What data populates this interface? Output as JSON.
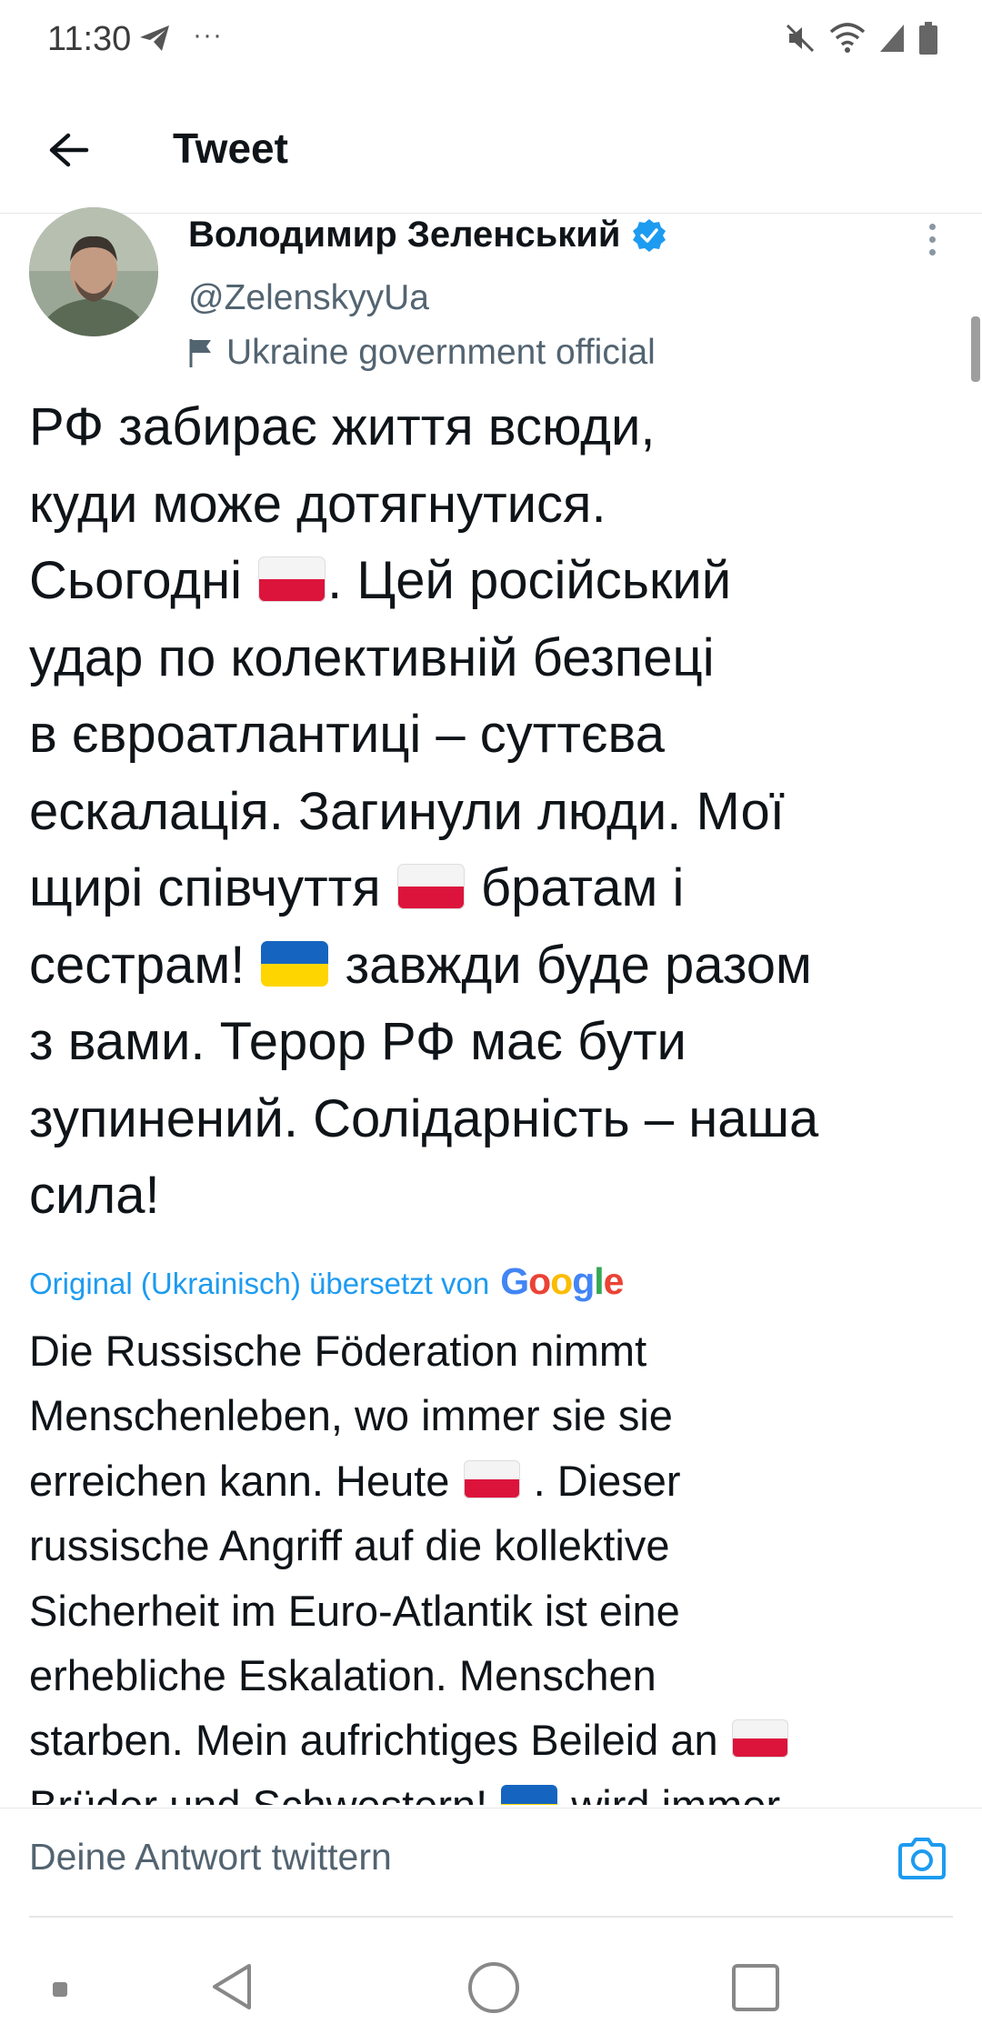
{
  "status_bar": {
    "time": "11:30",
    "notification_dots": "···",
    "icons": [
      "telegram-send-icon",
      "mute-icon",
      "wifi-icon",
      "signal-icon",
      "battery-icon"
    ]
  },
  "header": {
    "title": "Tweet"
  },
  "tweet": {
    "author_name": "Володимир Зеленський",
    "handle": "@ZelenskyyUa",
    "label": "Ukraine government official",
    "text_segments": [
      "РФ забирає життя всюди,",
      "куди може дотягнутися.",
      "Сьогодні ",
      ". Цей російський",
      "удар по колективній безпеці",
      "в євроатлантиці – суттєва",
      "ескалація. Загинули люди. Мої",
      "щирі співчуття ",
      " братам і",
      "сестрам! ",
      " завжди буде разом",
      "з вами. Терор РФ має бути",
      "зупинений. Солідарність – наша",
      "сила!"
    ],
    "translation_note": "Original (Ukrainisch) übersetzt von",
    "translation_provider": "Google",
    "translated_segments": [
      "Die Russische Föderation nimmt",
      "Menschenleben, wo immer sie sie",
      "erreichen kann. Heute ",
      " . Dieser",
      "russische Angriff auf die kollektive",
      "Sicherheit im Euro-Atlantik ist eine",
      "erhebliche Eskalation. Menschen",
      "starben. Mein aufrichtiges Beileid an ",
      "Brüder und Schwestern! ",
      " wird immer"
    ],
    "colors": {
      "link_blue": "#1d9bf0",
      "verified_blue": "#1d9bf0",
      "flag_poland": [
        "#f4f4f4",
        "#dc143c"
      ],
      "flag_ukraine": [
        "#1565c0",
        "#ffd500"
      ]
    }
  },
  "reply": {
    "placeholder": "Deine Antwort twittern"
  }
}
